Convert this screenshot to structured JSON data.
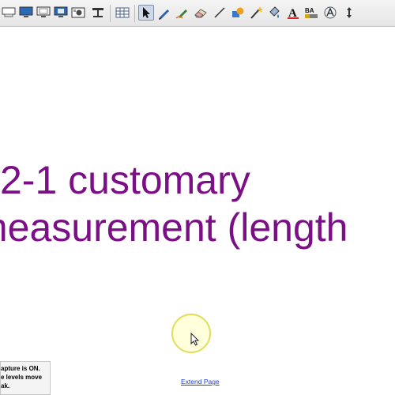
{
  "toolbar": {
    "tools": [
      {
        "name": "screen-shade-icon",
        "active": false
      },
      {
        "name": "monitor-icon",
        "active": false
      },
      {
        "name": "monitor-window-icon",
        "active": false
      },
      {
        "name": "monitor-capture-icon",
        "active": false
      },
      {
        "name": "image-capture-icon",
        "active": false
      },
      {
        "name": "document-camera-icon",
        "active": false
      },
      {
        "name": "table-icon",
        "active": false
      },
      {
        "name": "select-arrow-icon",
        "active": true
      },
      {
        "name": "pen-icon",
        "active": false
      },
      {
        "name": "creative-pen-icon",
        "active": false
      },
      {
        "name": "eraser-icon",
        "active": false
      },
      {
        "name": "line-icon",
        "active": false
      },
      {
        "name": "shapes-icon",
        "active": false
      },
      {
        "name": "magic-pen-icon",
        "active": false
      },
      {
        "name": "fill-icon",
        "active": false
      },
      {
        "name": "text-icon",
        "active": false
      },
      {
        "name": "properties-icon",
        "active": false
      },
      {
        "name": "handwriting-icon",
        "active": false
      },
      {
        "name": "move-toolbar-icon",
        "active": false
      }
    ]
  },
  "page": {
    "title_line1": "2-1 customary",
    "title_line2": "measurement (length",
    "title_color": "#7b0f86"
  },
  "notice": {
    "line1": "apture is ON.",
    "line2": "e levels move",
    "line3": "ak."
  },
  "extend_page_label": "Extend Page"
}
